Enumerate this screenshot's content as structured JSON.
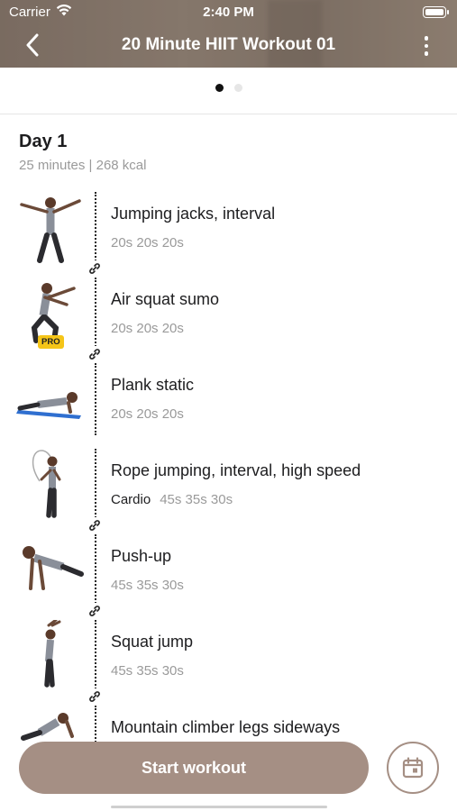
{
  "status_bar": {
    "carrier": "Carrier",
    "time": "2:40 PM"
  },
  "nav": {
    "title": "20 Minute HIIT Workout 01",
    "back_icon": "chevron-left-icon",
    "more_icon": "more-vertical-icon"
  },
  "pager": {
    "pages": 2,
    "active": 0
  },
  "day": {
    "title": "Day 1",
    "meta": "25 minutes | 268 kcal"
  },
  "exercises": [
    {
      "name": "Jumping jacks, interval",
      "tag": "",
      "sets": "20s 20s 20s",
      "pro": false,
      "linked": true
    },
    {
      "name": "Air squat sumo",
      "tag": "",
      "sets": "20s 20s 20s",
      "pro": true,
      "pro_label": "PRO",
      "linked": true
    },
    {
      "name": "Plank static",
      "tag": "",
      "sets": "20s 20s 20s",
      "pro": false,
      "linked": false
    },
    {
      "name": "Rope jumping, interval, high speed",
      "tag": "Cardio",
      "sets": "45s 35s 30s",
      "pro": false,
      "linked": true
    },
    {
      "name": "Push-up",
      "tag": "",
      "sets": "45s 35s 30s",
      "pro": false,
      "linked": true
    },
    {
      "name": "Squat jump",
      "tag": "",
      "sets": "45s 35s 30s",
      "pro": false,
      "linked": true
    },
    {
      "name": "Mountain climber legs sideways",
      "tag": "",
      "sets": "",
      "pro": false,
      "linked": false
    }
  ],
  "actions": {
    "start_label": "Start workout",
    "calendar_icon": "calendar-icon"
  },
  "colors": {
    "accent": "#a58f84",
    "header": "#8e8176"
  }
}
